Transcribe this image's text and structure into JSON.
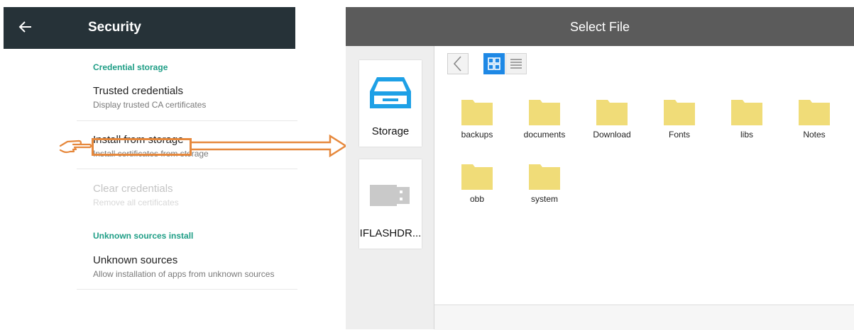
{
  "left": {
    "title": "Security",
    "sections": {
      "credential_storage": "Credential storage",
      "unknown_sources_install": "Unknown sources install"
    },
    "items": [
      {
        "title": "Trusted credentials",
        "subtitle": "Display trusted CA certificates"
      },
      {
        "title": "Install from storage",
        "subtitle": "Install certificates from storage"
      },
      {
        "title": "Clear credentials",
        "subtitle": "Remove all certificates"
      },
      {
        "title": "Unknown sources",
        "subtitle": "Allow installation of apps from unknown sources"
      }
    ]
  },
  "right": {
    "title": "Select File",
    "sources": [
      {
        "label": "Storage",
        "icon": "storage-tray-icon"
      },
      {
        "label": "IFLASHDR...",
        "icon": "usb-drive-icon"
      }
    ],
    "folders": [
      "backups",
      "documents",
      "Download",
      "Fonts",
      "libs",
      "Notes",
      "obb",
      "system"
    ]
  },
  "colors": {
    "left_header": "#263238",
    "section_label": "#1f9e86",
    "right_header": "#5b5b5b",
    "annotation": "#e6883c",
    "folder": "#f0dc78",
    "grid_view_active": "#1e88e5",
    "storage_icon": "#1ea0e6"
  }
}
